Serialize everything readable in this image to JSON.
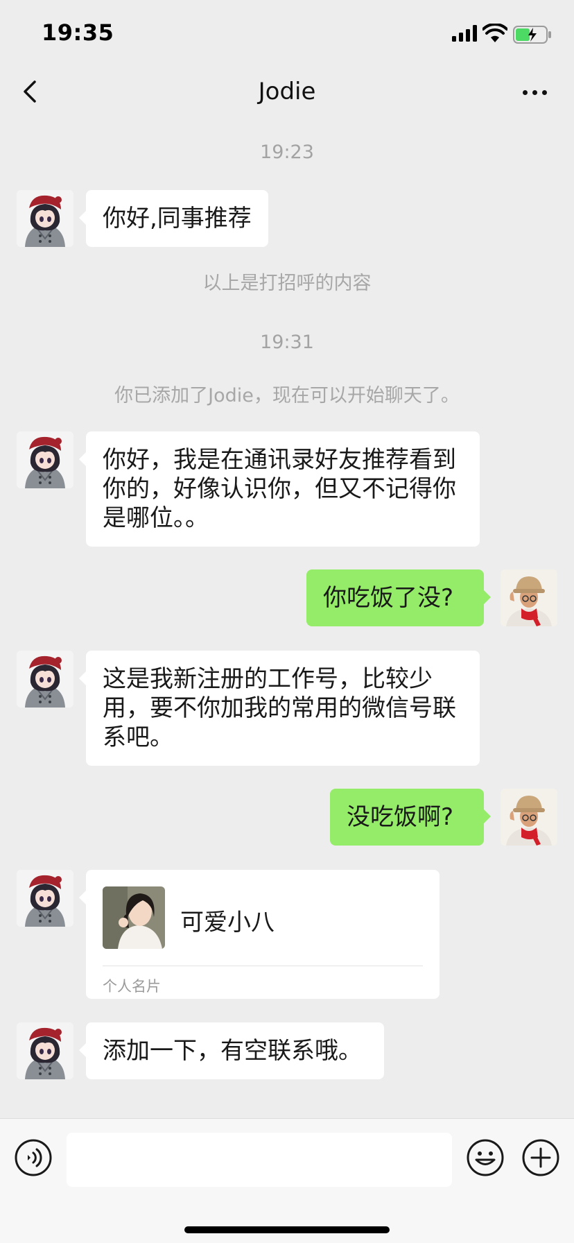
{
  "status_bar": {
    "time": "19:35",
    "battery_color": "#4cd964"
  },
  "nav": {
    "title": "Jodie",
    "back_icon": "chevron-left-icon",
    "more_icon": "ellipsis-icon"
  },
  "messages": [
    {
      "type": "time",
      "text": "19:23"
    },
    {
      "type": "text",
      "side": "left",
      "text": "你好,同事推荐"
    },
    {
      "type": "system",
      "text": "以上是打招呼的内容"
    },
    {
      "type": "time",
      "text": "19:31"
    },
    {
      "type": "system",
      "text": "你已添加了Jodie，现在可以开始聊天了。"
    },
    {
      "type": "text",
      "side": "left",
      "lines": [
        "你好，我是在通讯录好友推荐看到",
        "你的，好像认识你，但又不记得你",
        "是哪位。。"
      ]
    },
    {
      "type": "text",
      "side": "right",
      "text": "你吃饭了没?"
    },
    {
      "type": "text",
      "side": "left",
      "lines": [
        "这是我新注册的工作号，比较少",
        "用，要不你加我的常用的微信号联",
        "系吧。"
      ]
    },
    {
      "type": "text",
      "side": "right",
      "text": "没吃饭啊?"
    },
    {
      "type": "card",
      "side": "left",
      "name": "可爱小八",
      "label": "个人名片"
    },
    {
      "type": "text",
      "side": "left",
      "text": "添加一下，有空联系哦。"
    }
  ],
  "input_bar": {
    "voice_icon": "voice-icon",
    "emoji_icon": "emoji-icon",
    "plus_icon": "plus-icon",
    "input_value": ""
  },
  "colors": {
    "background": "#ededed",
    "bubble_self": "#95ec69",
    "bubble_other": "#ffffff",
    "meta_text": "#a3a3a3"
  }
}
